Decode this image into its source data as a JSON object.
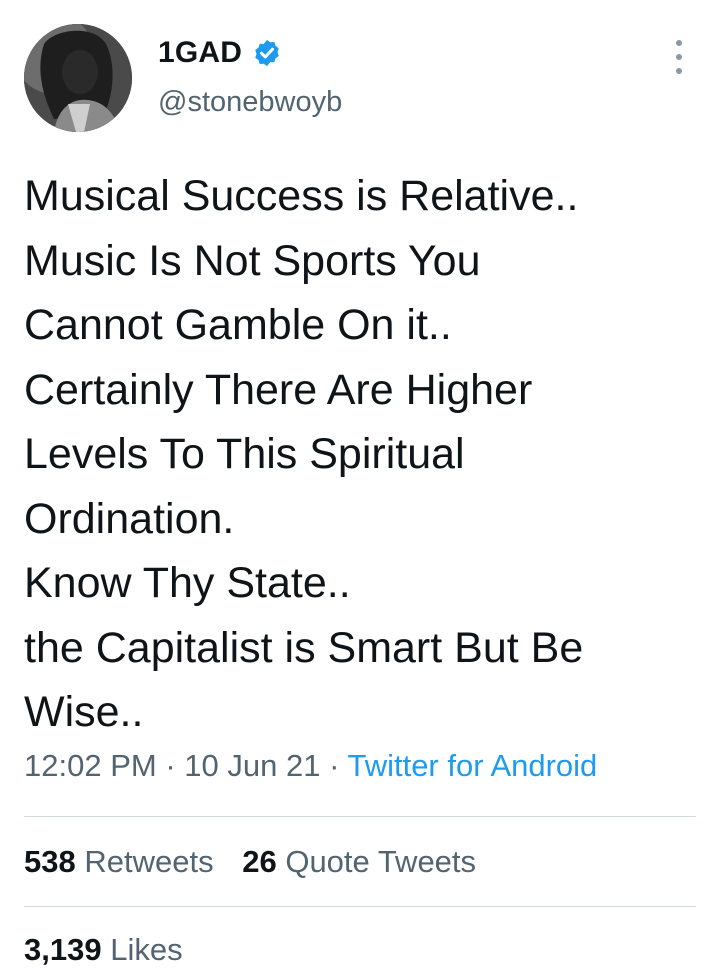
{
  "tweet": {
    "author": {
      "name": "1GAD",
      "handle": "@stonebwoyb",
      "verified": true
    },
    "text_lines": [
      "Musical Success is Relative..",
      "Music Is Not Sports You",
      "Cannot Gamble On it..",
      "Certainly There Are Higher",
      "Levels To This Spiritual",
      "Ordination.",
      "Know Thy State..",
      "the Capitalist is Smart But Be",
      "Wise.."
    ],
    "time": "12:02 PM",
    "date": "10 Jun 21",
    "separator": "·",
    "source": "Twitter for Android"
  },
  "stats": {
    "retweets_count": "538",
    "retweets_label": "Retweets",
    "quotes_count": "26",
    "quotes_label": "Quote Tweets",
    "likes_count": "3,139",
    "likes_label": "Likes"
  },
  "icons": {
    "verified": "verified-badge-icon",
    "more": "more-vertical-icon"
  },
  "colors": {
    "accent": "#1d9bf0",
    "text": "#0f1419",
    "secondary": "#536471",
    "divider": "#cfd9de"
  }
}
